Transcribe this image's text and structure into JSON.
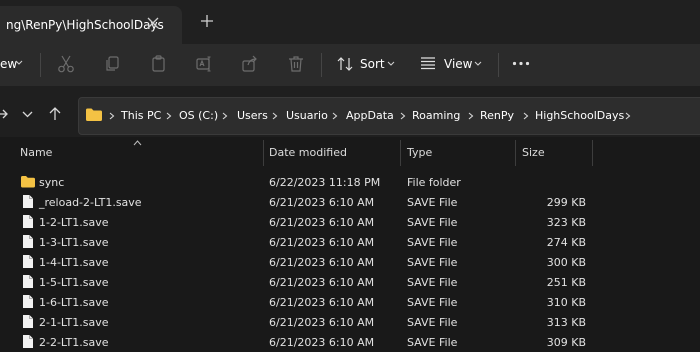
{
  "tab": {
    "title": "ng\\RenPy\\HighSchoolDays"
  },
  "toolbar": {
    "view_left_label": "ew",
    "sort_label": "Sort",
    "view_label": "View"
  },
  "breadcrumb": [
    "This PC",
    "OS (C:)",
    "Users",
    "Usuario",
    "AppData",
    "Roaming",
    "RenPy",
    "HighSchoolDays"
  ],
  "columns": {
    "name": "Name",
    "date": "Date modified",
    "type": "Type",
    "size": "Size"
  },
  "files": [
    {
      "name": "sync",
      "date": "6/22/2023 11:18 PM",
      "type": "File folder",
      "size": "",
      "kind": "folder"
    },
    {
      "name": "_reload-2-LT1.save",
      "date": "6/21/2023 6:10 AM",
      "type": "SAVE File",
      "size": "299 KB",
      "kind": "file"
    },
    {
      "name": "1-2-LT1.save",
      "date": "6/21/2023 6:10 AM",
      "type": "SAVE File",
      "size": "323 KB",
      "kind": "file"
    },
    {
      "name": "1-3-LT1.save",
      "date": "6/21/2023 6:10 AM",
      "type": "SAVE File",
      "size": "274 KB",
      "kind": "file"
    },
    {
      "name": "1-4-LT1.save",
      "date": "6/21/2023 6:10 AM",
      "type": "SAVE File",
      "size": "300 KB",
      "kind": "file"
    },
    {
      "name": "1-5-LT1.save",
      "date": "6/21/2023 6:10 AM",
      "type": "SAVE File",
      "size": "251 KB",
      "kind": "file"
    },
    {
      "name": "1-6-LT1.save",
      "date": "6/21/2023 6:10 AM",
      "type": "SAVE File",
      "size": "310 KB",
      "kind": "file"
    },
    {
      "name": "2-1-LT1.save",
      "date": "6/21/2023 6:10 AM",
      "type": "SAVE File",
      "size": "313 KB",
      "kind": "file"
    },
    {
      "name": "2-2-LT1.save",
      "date": "6/21/2023 6:10 AM",
      "type": "SAVE File",
      "size": "309 KB",
      "kind": "file"
    }
  ],
  "colors": {
    "folder": "#f4c244",
    "accent": "#e6e6e6",
    "background": "#191919"
  }
}
